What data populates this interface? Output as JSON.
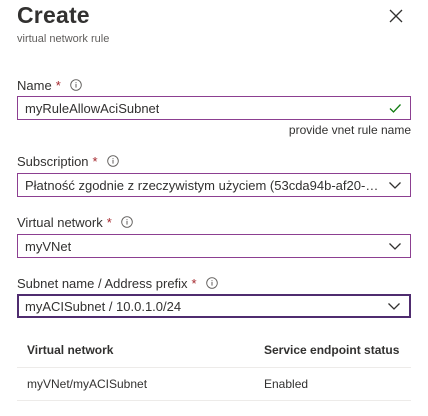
{
  "header": {
    "title": "Create",
    "subtitle": "virtual network rule"
  },
  "fields": {
    "name": {
      "label": "Name",
      "required_mark": "*",
      "value": "myRuleAllowAciSubnet",
      "hint": "provide vnet rule name"
    },
    "subscription": {
      "label": "Subscription",
      "required_mark": "*",
      "value": "Płatność zgodnie z rzeczywistym użyciem (53cda94b-af20-4..."
    },
    "virtual_network": {
      "label": "Virtual network",
      "required_mark": "*",
      "value": "myVNet"
    },
    "subnet": {
      "label": "Subnet name / Address prefix",
      "required_mark": "*",
      "value": "myACISubnet / 10.0.1.0/24"
    }
  },
  "table": {
    "headers": [
      "Virtual network",
      "Service endpoint status"
    ],
    "rows": [
      [
        "myVNet/myACISubnet",
        "Enabled"
      ]
    ]
  },
  "colors": {
    "accent": "#8c3f91",
    "focus": "#4f2c6f",
    "required": "#a4262c",
    "valid_check": "#107c10"
  },
  "icons": {
    "close": "close-icon",
    "info": "info-icon",
    "valid": "checkmark-icon",
    "dropdown": "chevron-down-icon"
  }
}
